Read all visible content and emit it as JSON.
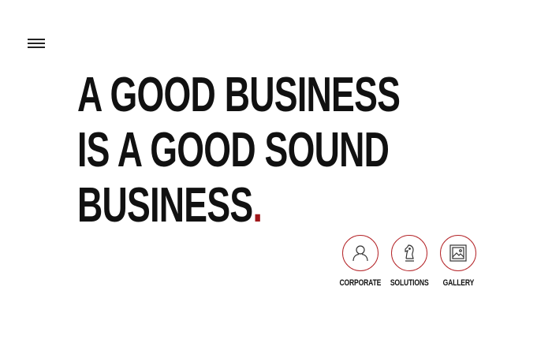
{
  "headline": {
    "line1": "A GOOD BUSINESS",
    "line2": "IS A GOOD SOUND",
    "line3": "BUSINESS",
    "dot": "."
  },
  "colors": {
    "accent": "#a0171a",
    "text": "#111111",
    "background": "#ffffff"
  },
  "menu": {
    "icon": "hamburger-icon"
  },
  "nav": [
    {
      "label": "CORPORATE",
      "icon": "person-icon"
    },
    {
      "label": "SOLUTIONS",
      "icon": "chess-knight-icon"
    },
    {
      "label": "GALLERY",
      "icon": "image-icon"
    }
  ]
}
